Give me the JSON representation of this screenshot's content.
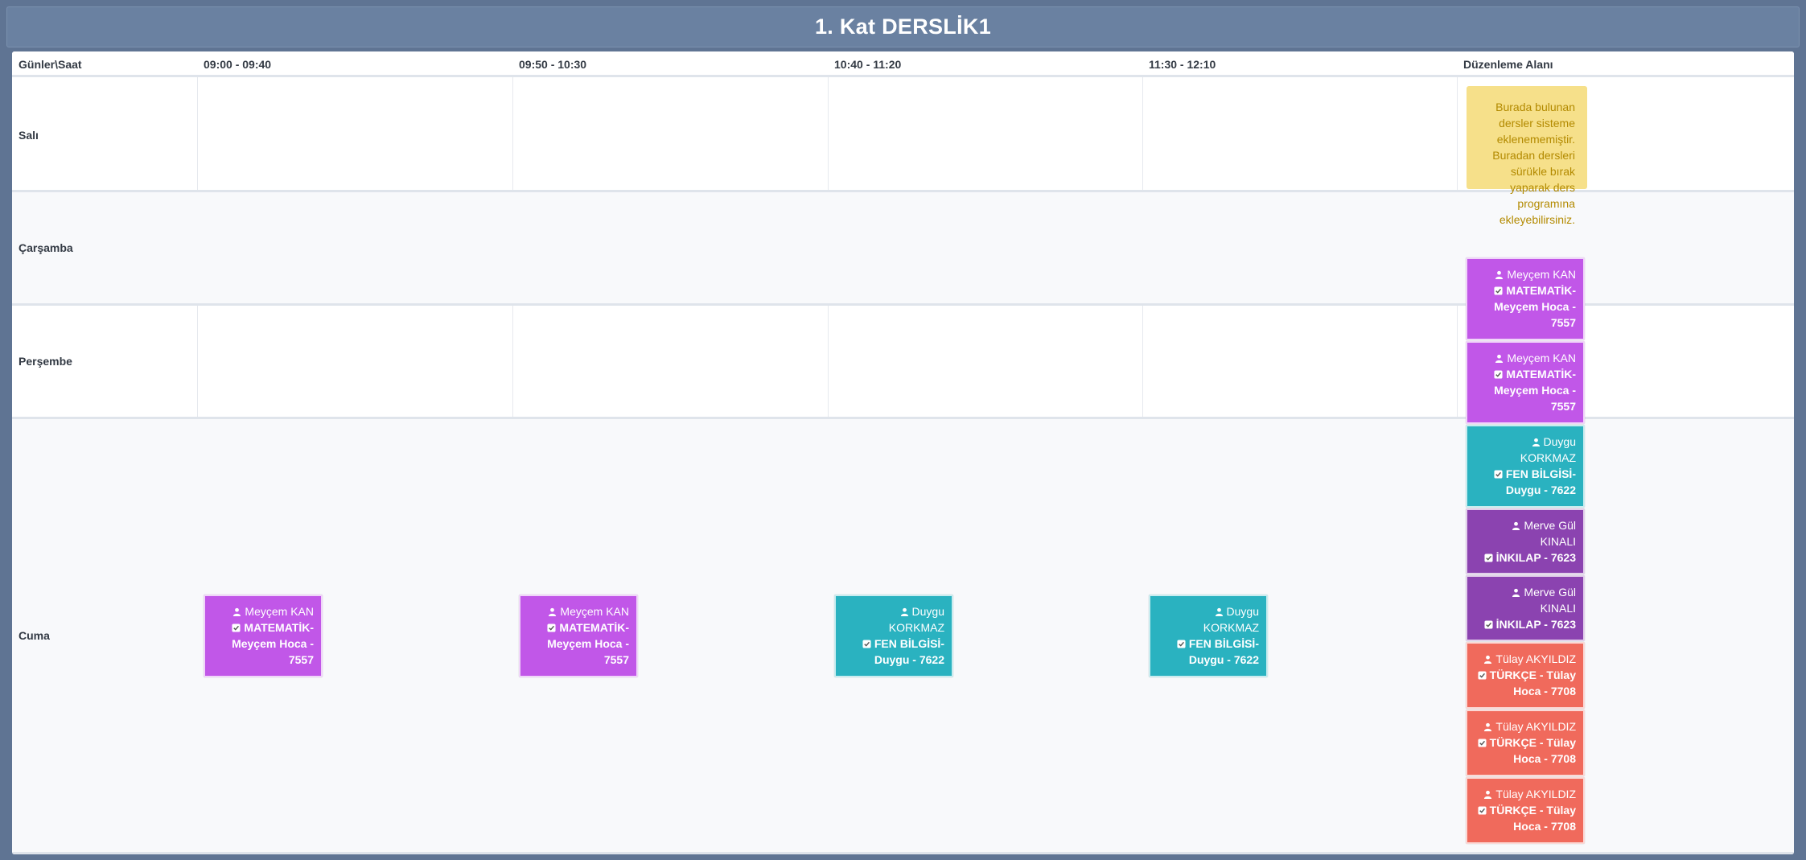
{
  "title": "1. Kat DERSLİK1",
  "header": {
    "corner": "Günler\\Saat",
    "slots": [
      "09:00 - 09:40",
      "09:50 - 10:30",
      "10:40 - 11:20",
      "11:30 - 12:10"
    ],
    "edit_area": "Düzenleme Alanı"
  },
  "days": [
    "Salı",
    "Çarşamba",
    "Perşembe",
    "Cuma"
  ],
  "edit_note": "Burada bulunan dersler sisteme eklenememiştir. Buradan dersleri sürükle bırak yaparak ders programına ekleyebilirsiniz.",
  "scheduled": [
    {
      "teacher": "Meyçem KAN",
      "lesson": "MATEMATİK-Meyçem Hoca - 7557",
      "color": "#c157e8"
    },
    {
      "teacher": "Meyçem KAN",
      "lesson": "MATEMATİK-Meyçem Hoca - 7557",
      "color": "#c157e8"
    },
    {
      "teacher": "Duygu KORKMAZ",
      "lesson": "FEN BİLGİSİ-Duygu - 7622",
      "color": "#2ab2c0"
    },
    {
      "teacher": "Duygu KORKMAZ",
      "lesson": "FEN BİLGİSİ-Duygu - 7622",
      "color": "#2ab2c0"
    }
  ],
  "unassigned": [
    {
      "teacher": "Meyçem KAN",
      "lesson": "MATEMATİK-Meyçem Hoca - 7557",
      "color": "#c157e8"
    },
    {
      "teacher": "Meyçem KAN",
      "lesson": "MATEMATİK-Meyçem Hoca - 7557",
      "color": "#c157e8"
    },
    {
      "teacher": "Duygu KORKMAZ",
      "lesson": "FEN BİLGİSİ-Duygu - 7622",
      "color": "#2ab2c0"
    },
    {
      "teacher": "Merve Gül KINALI",
      "lesson": "İNKILAP - 7623",
      "color": "#8b43b0"
    },
    {
      "teacher": "Merve Gül KINALI",
      "lesson": "İNKILAP - 7623",
      "color": "#8b43b0"
    },
    {
      "teacher": "Tülay AKYILDIZ",
      "lesson": "TÜRKÇE - Tülay Hoca - 7708",
      "color": "#f06a5c"
    },
    {
      "teacher": "Tülay AKYILDIZ",
      "lesson": "TÜRKÇE - Tülay Hoca - 7708",
      "color": "#f06a5c"
    },
    {
      "teacher": "Tülay AKYILDIZ",
      "lesson": "TÜRKÇE - Tülay Hoca - 7708",
      "color": "#f06a5c"
    }
  ],
  "icons": {
    "teacher": "user-icon",
    "lesson": "check-square-icon"
  }
}
